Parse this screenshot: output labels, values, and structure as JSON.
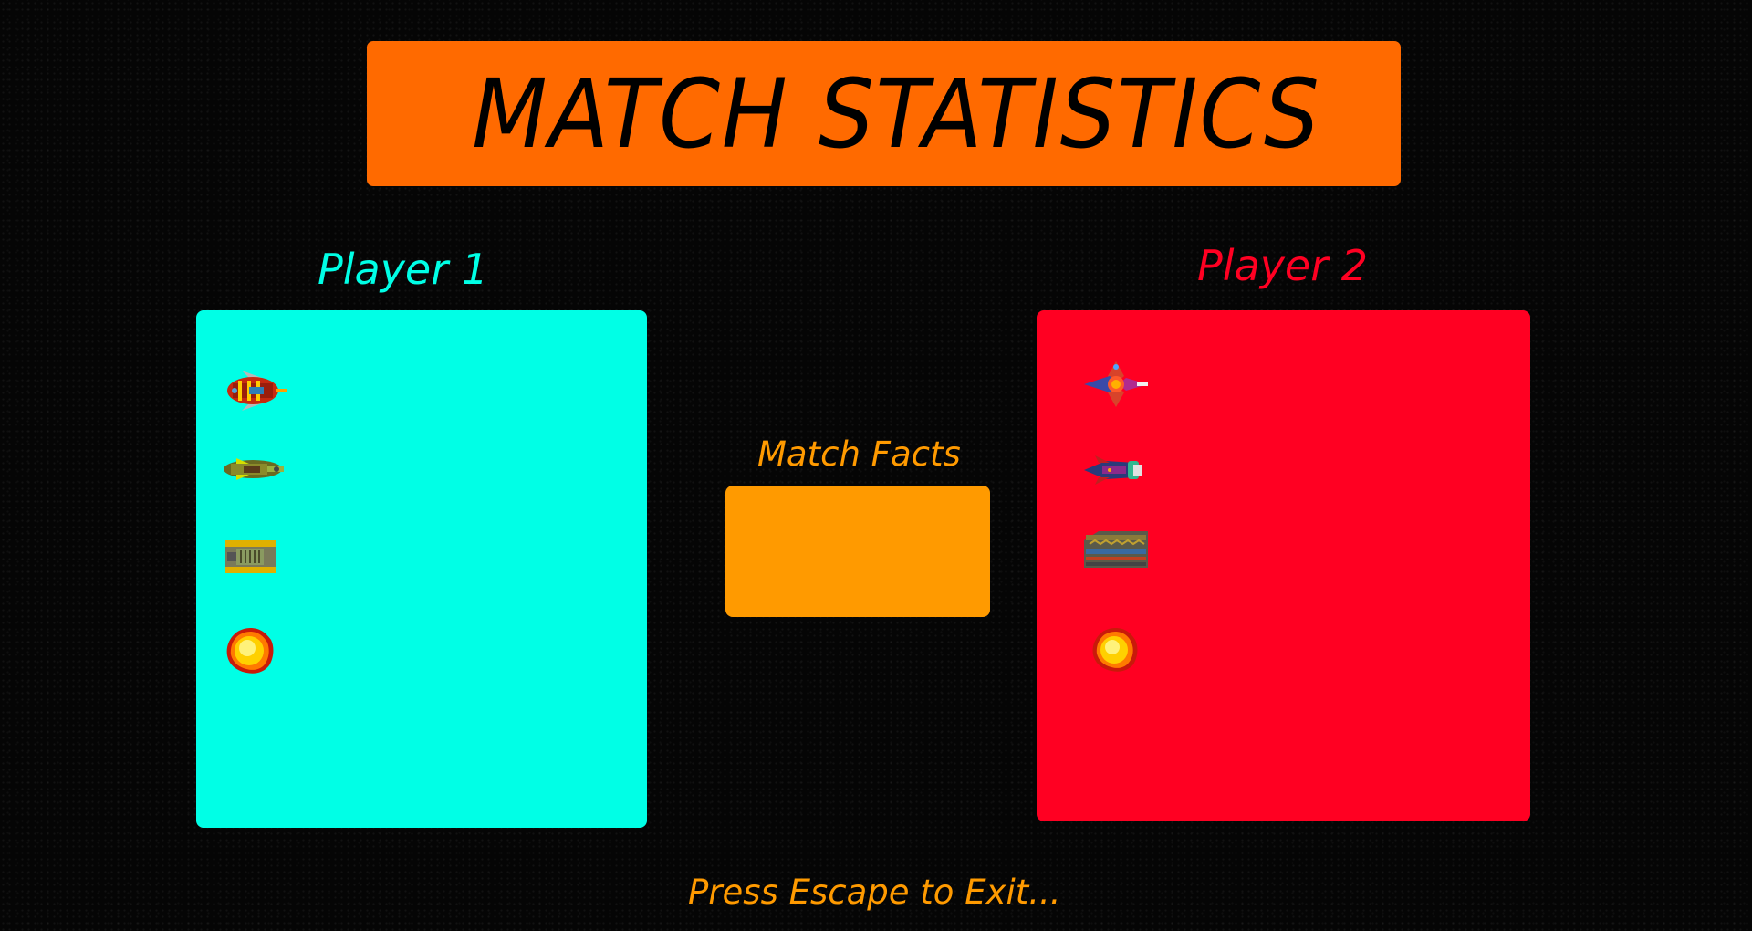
{
  "screen": {
    "title": "MATCH STATISTICS",
    "footer": "Press Escape to Exit..."
  },
  "player1": {
    "label": "Player 1",
    "color": "#00ffe6",
    "icons": [
      "ship-fighter-icon",
      "ship-scout-icon",
      "tank-icon",
      "explosion-icon"
    ]
  },
  "player2": {
    "label": "Player 2",
    "color": "#ff0022",
    "icons": [
      "ship-fighter-icon",
      "ship-scout-icon",
      "tank-icon",
      "explosion-icon"
    ]
  },
  "match_facts": {
    "label": "Match Facts",
    "color": "#ff9a00"
  },
  "colors": {
    "title_banner": "#ff6a00",
    "text_accent": "#ff9a00",
    "background": "#050505"
  }
}
